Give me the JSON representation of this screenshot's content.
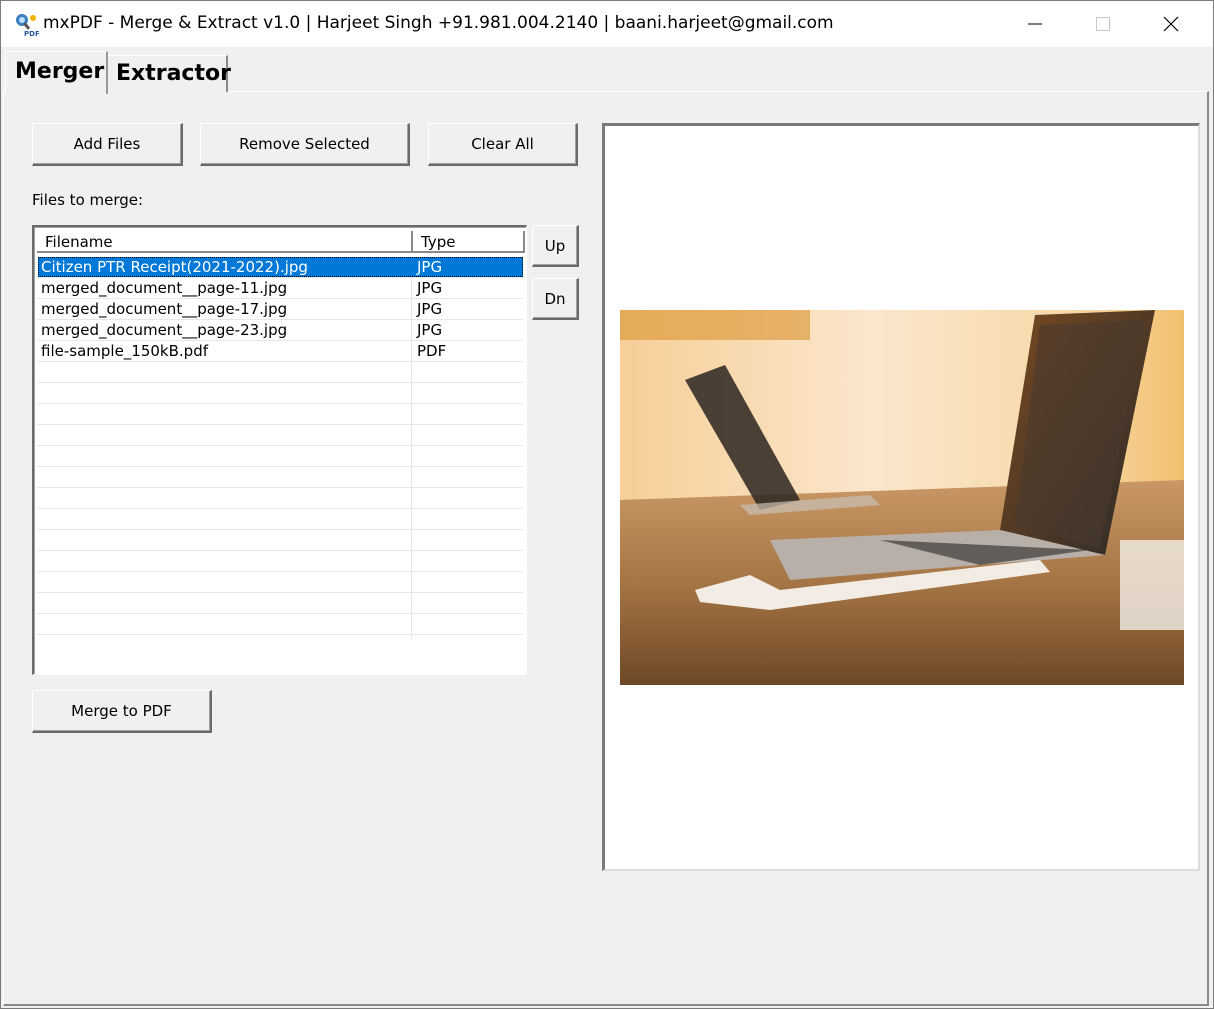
{
  "window": {
    "title": "mxPDF - Merge & Extract v1.0 | Harjeet Singh +91.981.004.2140 | baani.harjeet@gmail.com",
    "icon_text": "PDF"
  },
  "tabs": [
    {
      "label": "Merger",
      "active": true
    },
    {
      "label": "Extractor",
      "active": false
    }
  ],
  "toolbar": {
    "add_files": "Add Files",
    "remove_selected": "Remove Selected",
    "clear_all": "Clear All"
  },
  "files_label": "Files to merge:",
  "file_list": {
    "columns": [
      "Filename",
      "Type"
    ],
    "rows": [
      {
        "filename": "Citizen PTR Receipt(2021-2022).jpg",
        "type": "JPG",
        "selected": true
      },
      {
        "filename": "merged_document__page-11.jpg",
        "type": "JPG",
        "selected": false
      },
      {
        "filename": "merged_document__page-17.jpg",
        "type": "JPG",
        "selected": false
      },
      {
        "filename": "merged_document__page-23.jpg",
        "type": "JPG",
        "selected": false
      },
      {
        "filename": "file-sample_150kB.pdf",
        "type": "PDF",
        "selected": false
      }
    ]
  },
  "order_buttons": {
    "up": "Up",
    "down": "Dn"
  },
  "merge_button": "Merge to PDF",
  "colors": {
    "selection": "#0078d7",
    "background": "#f0f0f0"
  }
}
